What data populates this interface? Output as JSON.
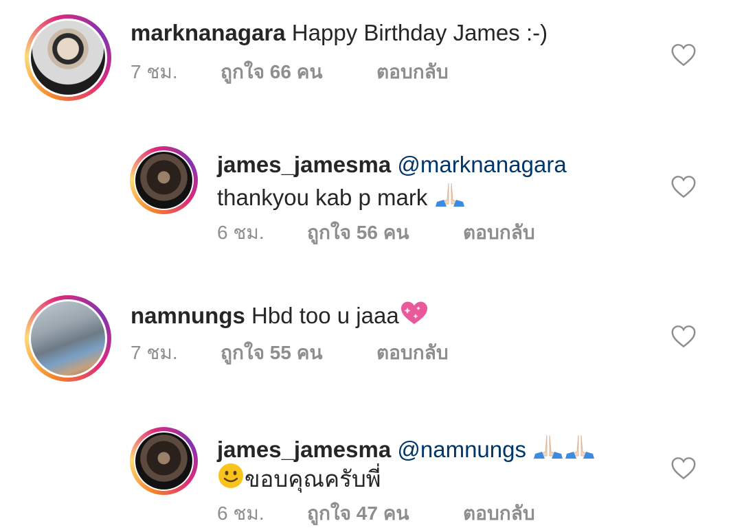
{
  "comments": [
    {
      "username": "marknanagara",
      "mention": "",
      "text": "Happy Birthday James :-)",
      "time": "7 ชม.",
      "likes": "ถูกใจ 66 คน",
      "reply": "ตอบกลับ"
    },
    {
      "username": "james_jamesma",
      "mention": "@marknanagara",
      "text": "thankyou kab p mark",
      "time": "6 ชม.",
      "likes": "ถูกใจ 56 คน",
      "reply": "ตอบกลับ"
    },
    {
      "username": "namnungs",
      "mention": "",
      "text": "Hbd too u jaaa",
      "time": "7 ชม.",
      "likes": "ถูกใจ 55 คน",
      "reply": "ตอบกลับ"
    },
    {
      "username": "james_jamesma",
      "mention": "@namnungs",
      "text": "ขอบคุณครับพี่",
      "time": "6 ชม.",
      "likes": "ถูกใจ 47 คน",
      "reply": "ตอบกลับ"
    }
  ],
  "icons": {
    "heart": "heart-outline-icon",
    "pray": "folded-hands-emoji",
    "sparkle_heart": "sparkling-heart-emoji",
    "smile": "smiling-face-emoji"
  },
  "colors": {
    "mention": "#00376b",
    "meta": "#8e8e8e",
    "text": "#262626"
  }
}
